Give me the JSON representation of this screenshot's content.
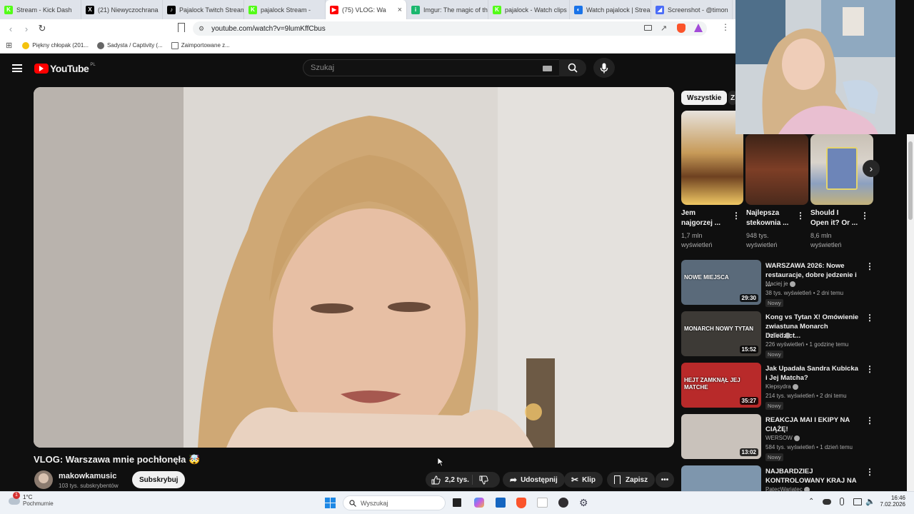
{
  "browser": {
    "tabs": [
      {
        "label": "Stream - Kick Dash",
        "color": "#53fc18",
        "glyph": "K"
      },
      {
        "label": "(21) Niewyczochrana",
        "color": "#000000",
        "glyph": "X"
      },
      {
        "label": "Pajalock Twitch Stream",
        "color": "#000000",
        "glyph": "♪"
      },
      {
        "label": "pajalock Stream -",
        "color": "#53fc18",
        "glyph": "K"
      },
      {
        "label": "(75) VLOG: Wa",
        "color": "#ff0000",
        "glyph": "▶",
        "active": true
      },
      {
        "label": "Imgur: The magic of th",
        "color": "#1bb76e",
        "glyph": "i"
      },
      {
        "label": "pajalock - Watch clips",
        "color": "#53fc18",
        "glyph": "K"
      },
      {
        "label": "Watch pajalock | Strea",
        "color": "#1a73e8",
        "glyph": "◐"
      },
      {
        "label": "Screenshot - @timon",
        "color": "#4a6cf7",
        "glyph": "◢"
      }
    ],
    "url": "youtube.com/watch?v=9lumKffCbus",
    "bookmarks": [
      "Piękny chłopak (201...",
      "Sadysta / Captivity (...",
      "Zaimportowane z..."
    ]
  },
  "youtube": {
    "logo_text": "YouTube",
    "region": "PL",
    "search_placeholder": "Szukaj",
    "video_title": "VLOG: Warszawa mnie pochłonęła 🤯",
    "channel_name": "makowkamusic",
    "subscribers": "103 tys. subskrybentów",
    "subscribe_label": "Subskrybuj",
    "likes": "2,2 tys.",
    "share_label": "Udostępnij",
    "clip_label": "Klip",
    "save_label": "Zapisz",
    "chips": [
      "Wszystkie",
      "Z"
    ],
    "shorts": [
      {
        "title1": "Jem",
        "title2": "najgorzej ...",
        "views": "1,7 mln",
        "meta2": "wyświetleń"
      },
      {
        "title1": "Najlepsza",
        "title2": "stekownia ...",
        "views": "948 tys.",
        "meta2": "wyświetleń"
      },
      {
        "title1": "Should I",
        "title2": "Open it? Or ...",
        "views": "8,6 mln",
        "meta2": "wyświetleń"
      }
    ],
    "videos": [
      {
        "title": "WARSZAWA 2026: Nowe restauracje, dobre jedzenie i ...",
        "channel": "Maciej je",
        "meta": "38 tys. wyświetleń • 2 dni temu",
        "badge": "Nowy",
        "duration": "29:30",
        "thumb_text": "NOWE MIEJSCA",
        "thumb_color": "#5a6a7a"
      },
      {
        "title": "Kong vs Tytan X! Omówienie zwiastuna Monarch Dziedzict...",
        "channel": "Halfish",
        "meta": "226 wyświetleń • 1 godzinę temu",
        "badge": "Nowy",
        "duration": "15:52",
        "thumb_text": "MONARCH  NOWY TYTAN",
        "thumb_color": "#3d3a36"
      },
      {
        "title": "Jak Upadała Sandra Kubicka i Jej Matcha?",
        "channel": "Klepsydra",
        "meta": "214 tys. wyświetleń • 2 dni temu",
        "badge": "Nowy",
        "duration": "35:27",
        "thumb_text": "HEJT ZAMKNĄŁ JEJ MATCHE",
        "thumb_color": "#b82a2a"
      },
      {
        "title": "REAKCJA MAI I EKIPY NA CIĄŻĘ!",
        "channel": "WERSOW",
        "meta": "584 tys. wyświetleń • 1 dzień temu",
        "badge": "Nowy",
        "duration": "13:02",
        "thumb_text": "",
        "thumb_color": "#c9c2bb"
      },
      {
        "title": "NAJBARDZIEJ KONTROLOWANY KRAJ NA ...",
        "channel": "PatecWariatec",
        "meta": "",
        "badge": "",
        "duration": "",
        "thumb_text": "",
        "thumb_color": "#7e96ad"
      }
    ]
  },
  "taskbar": {
    "temperature": "1°C",
    "weather": "Pochmurnie",
    "search_placeholder": "Wyszukaj",
    "time": "16:46",
    "date": "7.02.2026",
    "notification_count": "1"
  }
}
